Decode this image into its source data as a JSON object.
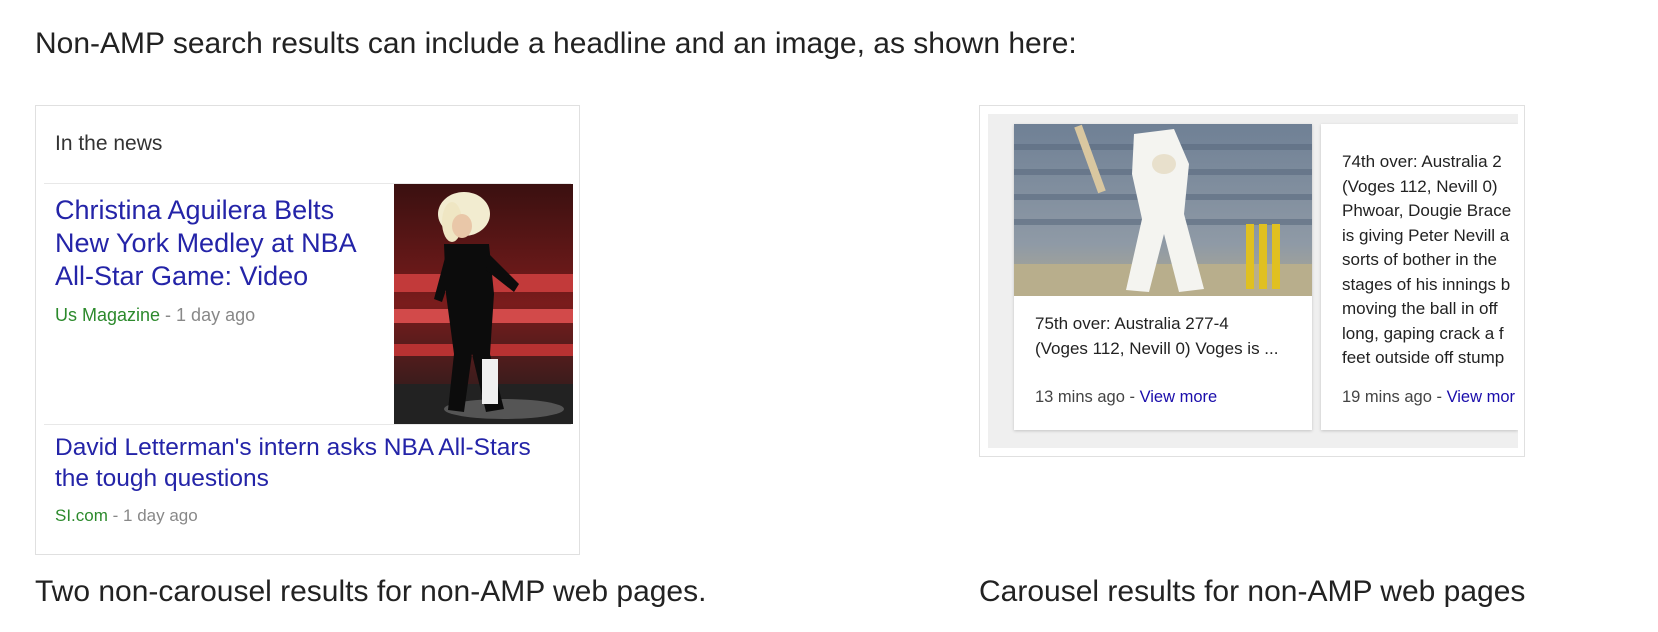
{
  "intro": "Non-AMP search results can include a headline and an image, as shown here:",
  "left_panel": {
    "heading": "In the news",
    "items": [
      {
        "title_lines": [
          "Christina Aguilera Belts",
          "New York Medley at NBA",
          "All-Star Game: Video"
        ],
        "source": "Us Magazine",
        "separator": " - ",
        "age": "1 day ago"
      },
      {
        "title_lines": [
          "David Letterman's intern asks NBA All-Stars",
          "the tough questions"
        ],
        "source": "SI.com",
        "separator": " - ",
        "age": "1 day ago"
      }
    ],
    "caption": "Two non-carousel results for non-AMP web pages."
  },
  "right_panel": {
    "cards": [
      {
        "text_lines": [
          "75th over: Australia 277-4",
          "(Voges 112, Nevill 0) Voges is ..."
        ],
        "age": "13 mins ago",
        "separator": " - ",
        "link": "View more"
      },
      {
        "text_lines": [
          "74th over: Australia 2",
          "(Voges 112, Nevill 0)",
          "Phwoar, Dougie Brace",
          "is giving Peter Nevill a",
          "sorts of bother in the",
          "stages of his innings b",
          "moving the ball in off",
          "long, gaping crack a f",
          "feet outside off stump"
        ],
        "age": "19 mins ago",
        "separator": " - ",
        "link": "View mor"
      }
    ],
    "caption": "Carousel results for non-AMP web pages"
  },
  "colors": {
    "headline_link": "#2424a8",
    "source_green": "#2c8a2c",
    "view_more_link": "#1a0dab"
  }
}
